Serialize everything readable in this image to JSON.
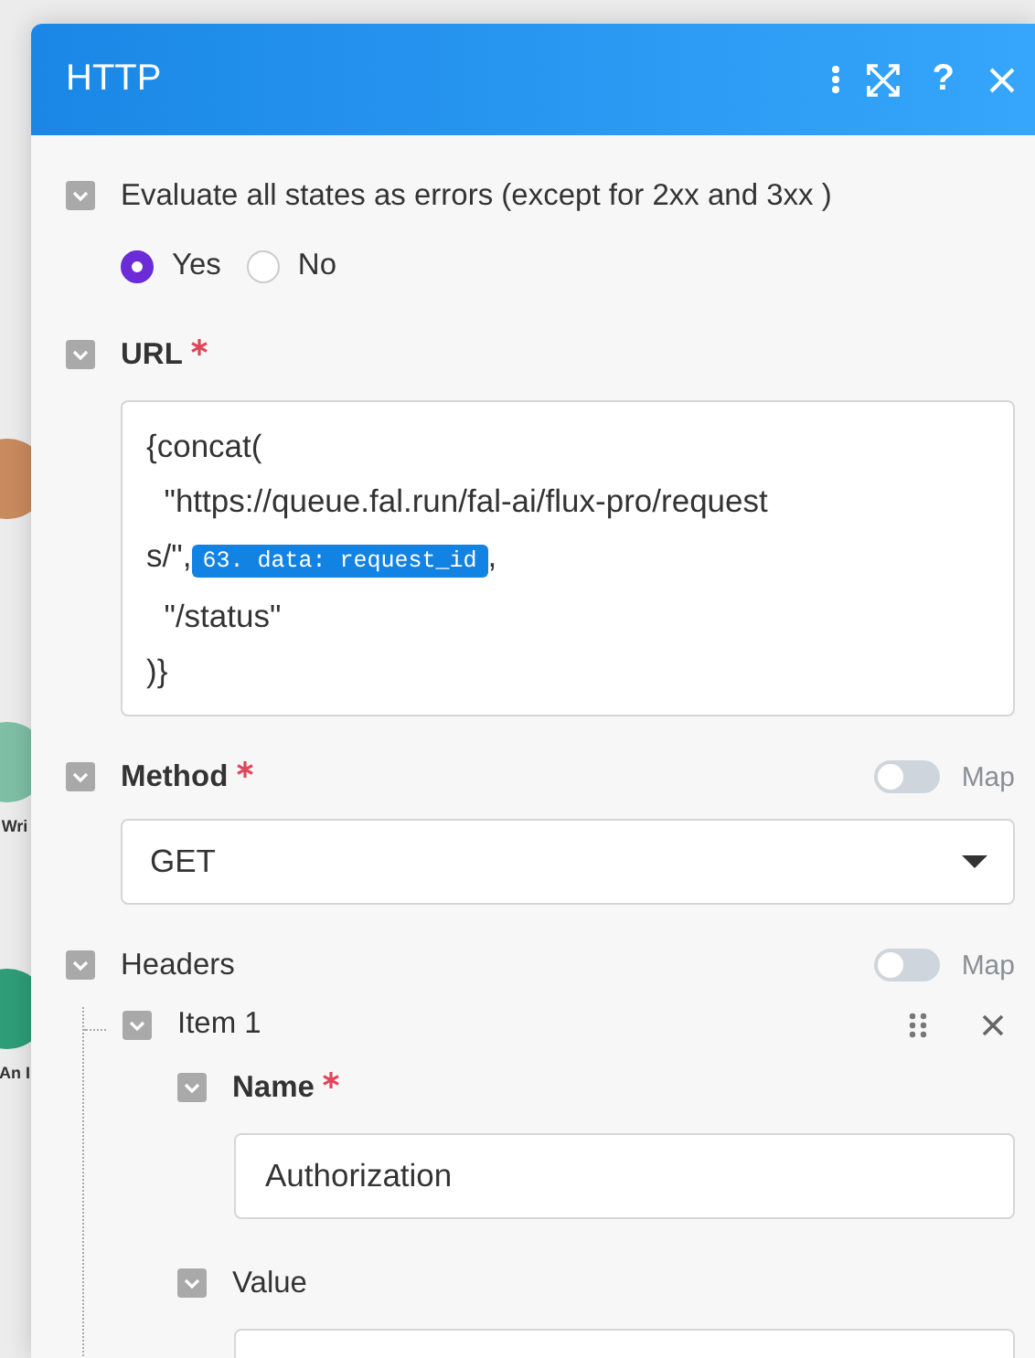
{
  "canvas_nodes": [
    {
      "color": "#c98a5e"
    },
    {
      "label": "Wri",
      "color": "#7fbfa6"
    },
    {
      "label": "An I",
      "color": "#2e9e78"
    }
  ],
  "panel": {
    "title": "HTTP",
    "help": "?"
  },
  "evaluate_errors": {
    "label": "Evaluate all states as errors (except for 2xx and 3xx )",
    "options": [
      {
        "label": "Yes",
        "selected": true
      },
      {
        "label": "No",
        "selected": false
      }
    ]
  },
  "url": {
    "label": "URL",
    "required": true,
    "segments": [
      {
        "kind": "text",
        "text": "{concat(\n  \"https://queue.fal.run/fal-ai/flux-pro/requests/\","
      },
      {
        "kind": "token",
        "text": "63. data: request_id"
      },
      {
        "kind": "text",
        "text": ",\n  \"/status\"\n)}"
      }
    ]
  },
  "method": {
    "label": "Method",
    "required": true,
    "map": false,
    "map_label": "Map",
    "value": "GET"
  },
  "headers": {
    "label": "Headers",
    "map": false,
    "map_label": "Map",
    "items": [
      {
        "label": "Item 1",
        "fields": [
          {
            "label": "Name",
            "required": true,
            "value": "Authorization"
          },
          {
            "label": "Value"
          }
        ]
      }
    ]
  }
}
